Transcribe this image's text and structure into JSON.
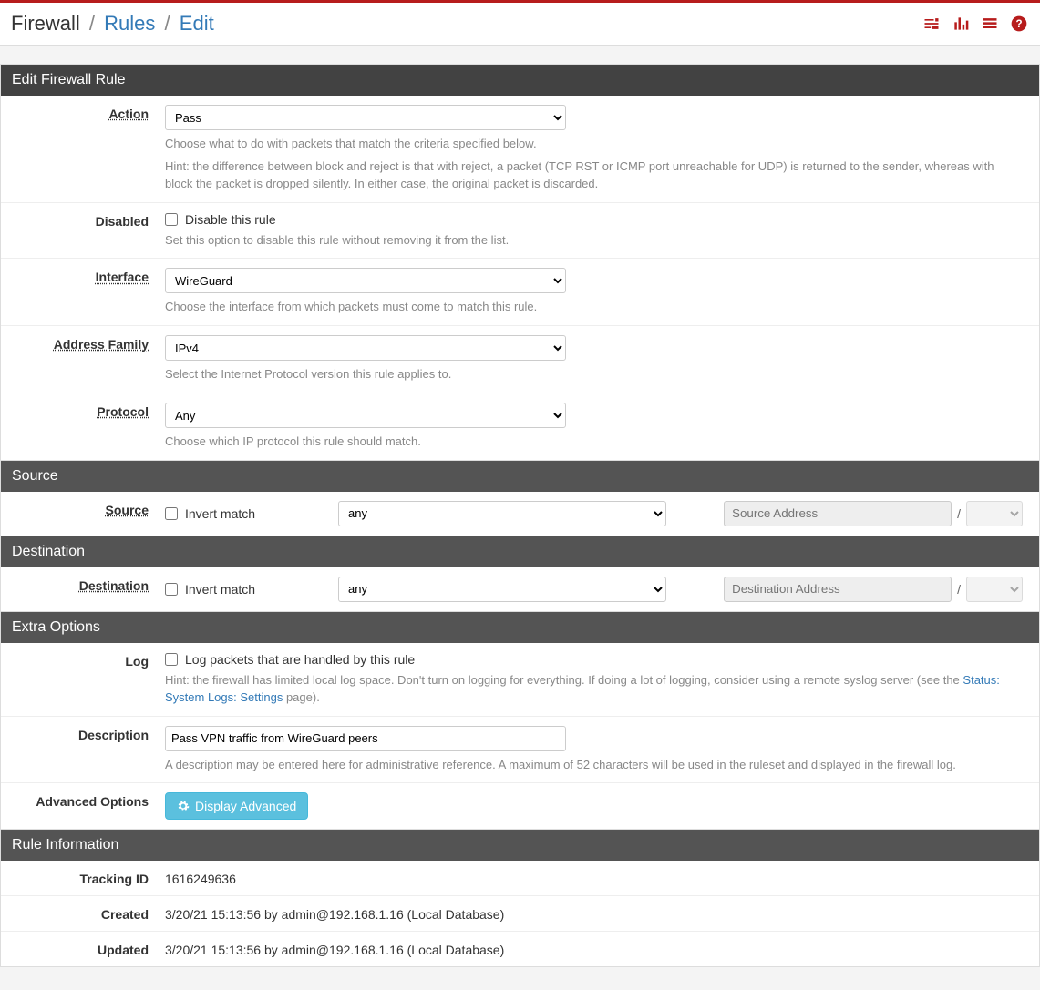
{
  "breadcrumb": {
    "root": "Firewall",
    "mid": "Rules",
    "leaf": "Edit"
  },
  "icons": {
    "settings": "settings-sliders-icon",
    "graph": "bar-chart-icon",
    "log": "list-icon",
    "help": "help-icon"
  },
  "sections": {
    "edit": {
      "title": "Edit Firewall Rule",
      "action": {
        "label": "Action",
        "value": "Pass",
        "help1": "Choose what to do with packets that match the criteria specified below.",
        "help2": "Hint: the difference between block and reject is that with reject, a packet (TCP RST or ICMP port unreachable for UDP) is returned to the sender, whereas with block the packet is dropped silently. In either case, the original packet is discarded."
      },
      "disabled": {
        "label": "Disabled",
        "chk_label": "Disable this rule",
        "checked": false,
        "help": "Set this option to disable this rule without removing it from the list."
      },
      "interface": {
        "label": "Interface",
        "value": "WireGuard",
        "help": "Choose the interface from which packets must come to match this rule."
      },
      "address_family": {
        "label": "Address Family",
        "value": "IPv4",
        "help": "Select the Internet Protocol version this rule applies to."
      },
      "protocol": {
        "label": "Protocol",
        "value": "Any",
        "help": "Choose which IP protocol this rule should match."
      }
    },
    "source": {
      "title": "Source",
      "label": "Source",
      "invert_label": "Invert match",
      "invert_checked": false,
      "type": "any",
      "addr_placeholder": "Source Address",
      "mask": ""
    },
    "destination": {
      "title": "Destination",
      "label": "Destination",
      "invert_label": "Invert match",
      "invert_checked": false,
      "type": "any",
      "addr_placeholder": "Destination Address",
      "mask": ""
    },
    "extra": {
      "title": "Extra Options",
      "log": {
        "label": "Log",
        "chk_label": "Log packets that are handled by this rule",
        "checked": false,
        "help_pre": "Hint: the firewall has limited local log space. Don't turn on logging for everything. If doing a lot of logging, consider using a remote syslog server (see the ",
        "help_link": "Status: System Logs: Settings",
        "help_post": " page)."
      },
      "description": {
        "label": "Description",
        "value": "Pass VPN traffic from WireGuard peers",
        "help": "A description may be entered here for administrative reference. A maximum of 52 characters will be used in the ruleset and displayed in the firewall log."
      },
      "advanced": {
        "label": "Advanced Options",
        "button": "Display Advanced"
      }
    },
    "info": {
      "title": "Rule Information",
      "tracking": {
        "label": "Tracking ID",
        "value": "1616249636"
      },
      "created": {
        "label": "Created",
        "value": "3/20/21 15:13:56 by admin@192.168.1.16 (Local Database)"
      },
      "updated": {
        "label": "Updated",
        "value": "3/20/21 15:13:56 by admin@192.168.1.16 (Local Database)"
      }
    }
  }
}
